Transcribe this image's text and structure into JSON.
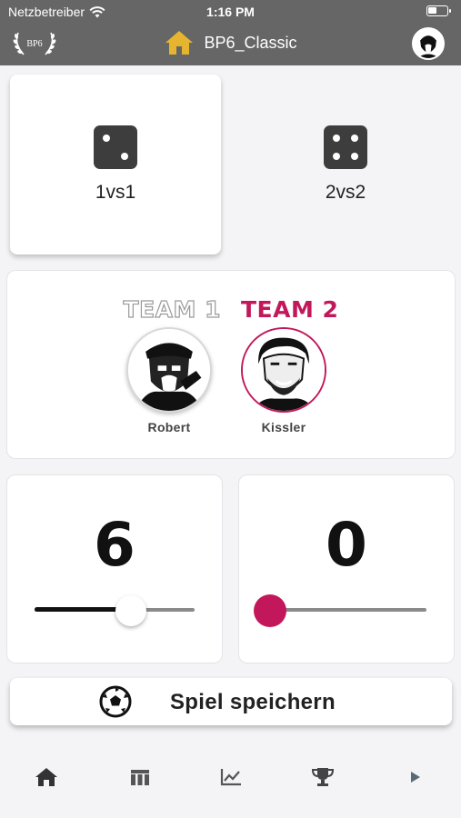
{
  "status_bar": {
    "carrier": "Netzbetreiber",
    "time": "1:16 PM",
    "battery_icon": "battery-icon"
  },
  "header": {
    "logo_text": "BP6",
    "title": "BP6_Classic",
    "icon": "home-icon",
    "background": "#666666",
    "home_icon_color": "#e6b530"
  },
  "modes": [
    {
      "label": "1vs1",
      "icon": "dice-two-icon",
      "selected": true
    },
    {
      "label": "2vs2",
      "icon": "dice-four-icon",
      "selected": false
    }
  ],
  "teams": {
    "team1_label": "TEAM 1",
    "team2_label": "TEAM 2",
    "team2_color": "#c2185b",
    "players": [
      {
        "name": "Robert",
        "team": 1
      },
      {
        "name": "Kissler",
        "team": 2
      }
    ]
  },
  "scores": [
    {
      "value": "6",
      "slider_fraction": 0.6,
      "thumb_color": "#ffffff"
    },
    {
      "value": "0",
      "slider_fraction": 0.0,
      "thumb_color": "#c2185b"
    }
  ],
  "save_button": {
    "label": "Spiel speichern",
    "icon": "soccer-ball-icon"
  },
  "bottom_nav": [
    {
      "icon": "home-icon"
    },
    {
      "icon": "table-icon"
    },
    {
      "icon": "chart-icon"
    },
    {
      "icon": "trophy-icon"
    },
    {
      "icon": "play-icon"
    }
  ]
}
